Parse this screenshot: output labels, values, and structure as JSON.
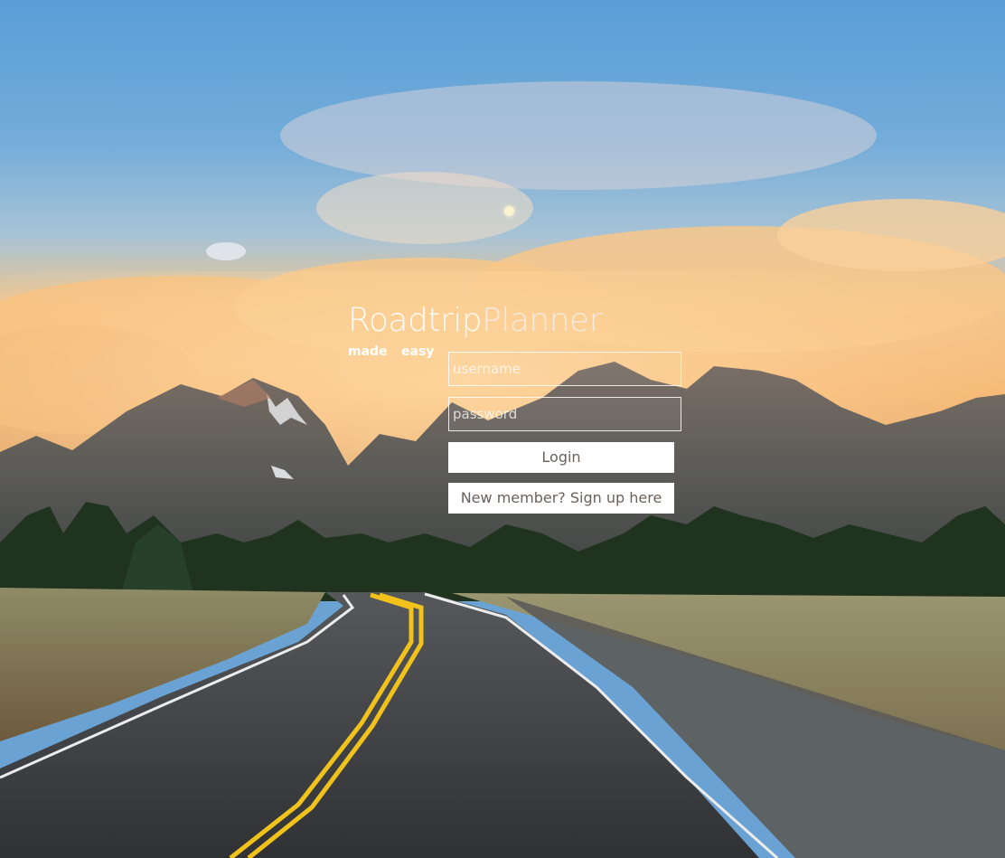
{
  "brand": {
    "part1": "Roadtrip",
    "part2": "Planner",
    "tagline_1": "made",
    "tagline_2": "easy"
  },
  "form": {
    "username_placeholder": "username",
    "username_value": "",
    "password_placeholder": "password",
    "password_value": "",
    "login_label": "Login",
    "signup_label": "New member? Sign up here"
  },
  "colors": {
    "sky_top": "#5d9fd7",
    "sky_glow": "#f7c27f",
    "mountain": "#5f5d58",
    "forest": "#20331f",
    "grass": "#8d8a64",
    "road": "#3b3d40",
    "center_line": "#f1c21b",
    "button_bg": "#ffffff",
    "button_text": "#6b625c"
  },
  "icons": [
    "moon-icon"
  ]
}
